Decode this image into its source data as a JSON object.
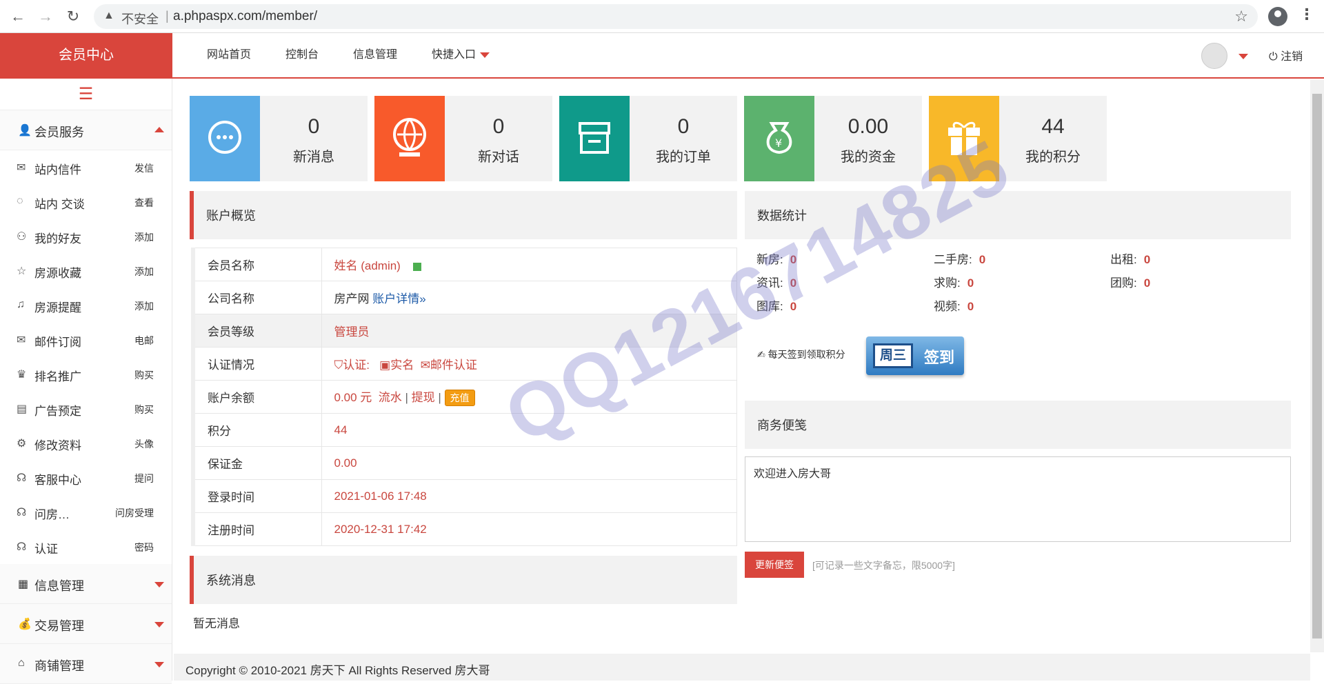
{
  "browser": {
    "insecure_label": "不安全",
    "url": "a.phpaspx.com/member/"
  },
  "header": {
    "brand": "会员中心",
    "nav": [
      "网站首页",
      "控制台",
      "信息管理",
      "快捷入口"
    ],
    "logout": "注销"
  },
  "sidebar": {
    "group_member": "会员服务",
    "items": [
      {
        "label": "站内信件",
        "action": "发信",
        "icon": "mail-icon"
      },
      {
        "label": "站内 交谈",
        "action": "查看",
        "icon": "chat-icon"
      },
      {
        "label": "我的好友",
        "action": "添加",
        "icon": "user-icon"
      },
      {
        "label": "房源收藏",
        "action": "添加",
        "icon": "star-icon"
      },
      {
        "label": "房源提醒",
        "action": "添加",
        "icon": "bell-icon"
      },
      {
        "label": "邮件订阅",
        "action": "电邮",
        "icon": "mail-icon"
      },
      {
        "label": "排名推广",
        "action": "购买",
        "icon": "trophy-icon"
      },
      {
        "label": "广告预定",
        "action": "购买",
        "icon": "ad-icon"
      },
      {
        "label": "修改资料",
        "action": "头像",
        "icon": "gear-icon"
      },
      {
        "label": "客服中心",
        "action": "提问",
        "icon": "headset-icon"
      },
      {
        "label": "问房…",
        "action": "问房受理",
        "icon": "headset-icon"
      },
      {
        "label": "认证",
        "action": "密码",
        "icon": "headset-icon"
      }
    ],
    "group_info": "信息管理",
    "group_trade": "交易管理",
    "group_shop": "商铺管理"
  },
  "cards": [
    {
      "value": "0",
      "label": "新消息",
      "color": "#5aabe6"
    },
    {
      "value": "0",
      "label": "新对话",
      "color": "#f85a2b"
    },
    {
      "value": "0",
      "label": "我的订单",
      "color": "#0f9a8a"
    },
    {
      "value": "0.00",
      "label": "我的资金",
      "color": "#5cb26e"
    },
    {
      "value": "44",
      "label": "我的积分",
      "color": "#f8b829"
    }
  ],
  "account": {
    "title": "账户概览",
    "rows": {
      "name_k": "会员名称",
      "name_v": "姓名 (admin)",
      "company_k": "公司名称",
      "company_v": "房产网",
      "company_link": "账户详情»",
      "level_k": "会员等级",
      "level_v": "管理员",
      "auth_k": "认证情况",
      "auth_label": "认证:",
      "auth_real": "实名",
      "auth_mail": "邮件认证",
      "balance_k": "账户余额",
      "balance_v": "0.00 元",
      "flow": "流水",
      "withdraw": "提现",
      "recharge": "充值",
      "points_k": "积分",
      "points_v": "44",
      "deposit_k": "保证金",
      "deposit_v": "0.00",
      "login_k": "登录时间",
      "login_v": "2021-01-06 17:48",
      "reg_k": "注册时间",
      "reg_v": "2020-12-31 17:42"
    }
  },
  "stats": {
    "title": "数据统计",
    "items": [
      {
        "label": "新房:",
        "value": "0"
      },
      {
        "label": "二手房:",
        "value": "0"
      },
      {
        "label": "出租:",
        "value": "0"
      },
      {
        "label": "资讯:",
        "value": "0"
      },
      {
        "label": "求购:",
        "value": "0"
      },
      {
        "label": "团购:",
        "value": "0"
      },
      {
        "label": "图库:",
        "value": "0"
      },
      {
        "label": "视频:",
        "value": "0"
      }
    ],
    "signin_note": "每天签到领取积分",
    "signin_day": "周三",
    "signin_label": "签到"
  },
  "memo": {
    "title": "商务便笺",
    "text": "欢迎进入房大哥",
    "button": "更新便签",
    "hint": "[可记录一些文字备忘，限5000字]"
  },
  "system": {
    "title": "系统消息",
    "empty": "暂无消息"
  },
  "footer": "Copyright © 2010-2021 房天下 All Rights Reserved 房大哥",
  "watermark": "QQ1216714825"
}
